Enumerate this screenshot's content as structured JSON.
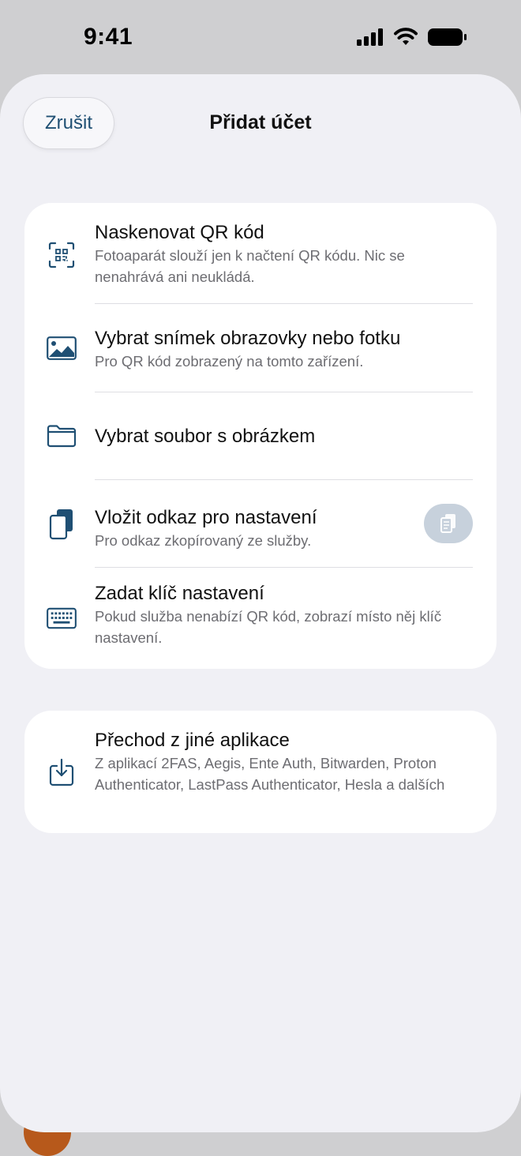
{
  "status": {
    "time": "9:41"
  },
  "header": {
    "cancel_label": "Zrušit",
    "title": "Přidat účet"
  },
  "options": [
    {
      "icon": "qr-scan-icon",
      "title": "Naskenovat QR kód",
      "subtitle": "Fotoaparát slouží jen k načtení QR kódu. Nic se nenahrává ani neukládá."
    },
    {
      "icon": "photo-icon",
      "title": "Vybrat snímek obrazovky nebo fotku",
      "subtitle": "Pro QR kód zobrazený na tomto zařízení."
    },
    {
      "icon": "folder-icon",
      "title": "Vybrat soubor s obrázkem",
      "subtitle": ""
    },
    {
      "icon": "paste-link-icon",
      "title": "Vložit odkaz pro nastavení",
      "subtitle": "Pro odkaz zkopírovaný ze služby."
    },
    {
      "icon": "keyboard-icon",
      "title": "Zadat klíč nastavení",
      "subtitle": "Pokud služba nenabízí QR kód, zobrazí místo něj klíč nastavení."
    }
  ],
  "import": {
    "icon": "import-icon",
    "title": "Přechod z jiné aplikace",
    "subtitle": "Z aplikací 2FAS, Aegis, Ente Auth, Bitwarden, Proton Authenticator, LastPass Authenticator, Hesla a dalších"
  },
  "colors": {
    "accent": "#1f4f73",
    "sheet_bg": "#f0f0f5",
    "card_bg": "#ffffff",
    "paste_button": "#c7d1dc"
  }
}
